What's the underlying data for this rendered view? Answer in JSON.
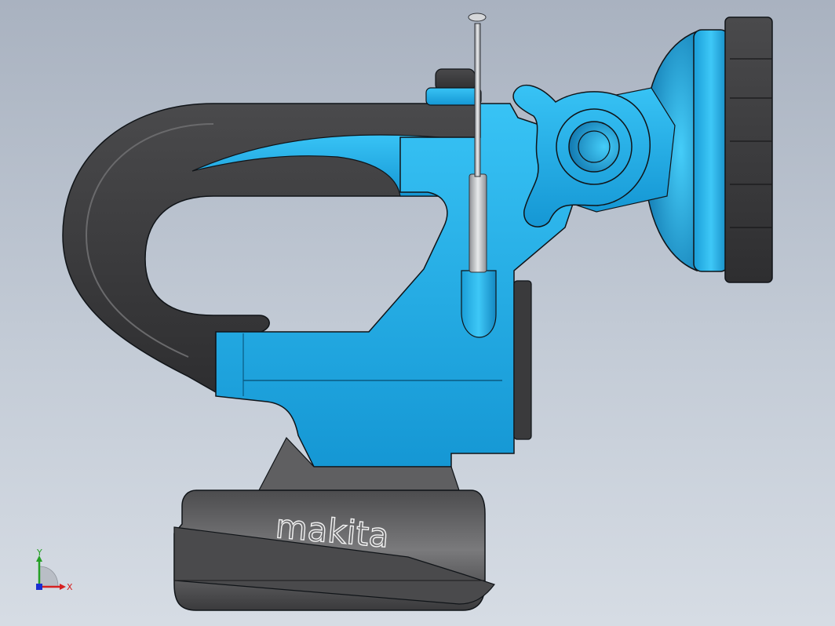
{
  "viewport": {
    "background_top": "#a9b2c0",
    "background_bottom": "#d6dce4"
  },
  "model": {
    "brand_text": "makita",
    "colors": {
      "body_blue": "#1fb1ec",
      "body_blue_dark": "#0f7fb4",
      "rubber_dark": "#3c3c3e",
      "rubber_mid": "#5a5a5c",
      "battery_gray": "#6e6e70",
      "antenna_silver": "#c9ccd0",
      "outline": "#101418"
    }
  },
  "triad": {
    "x_label": "X",
    "y_label": "Y",
    "x_color": "#d62020",
    "y_color": "#25a025",
    "z_color": "#1a2fd1"
  }
}
